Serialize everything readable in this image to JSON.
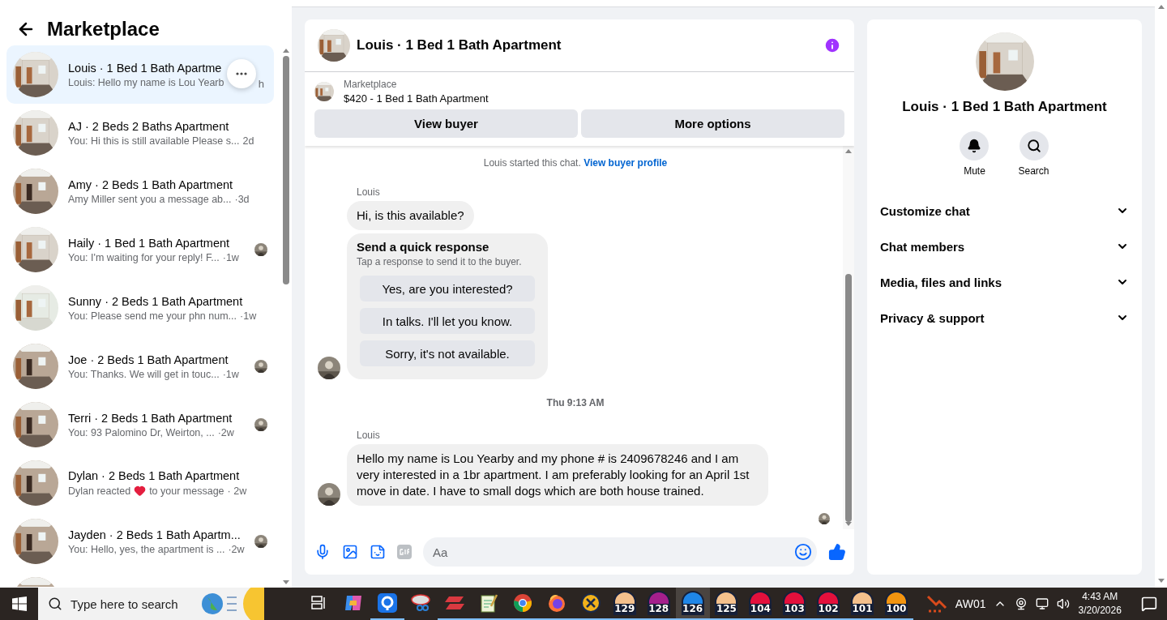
{
  "header": {
    "title": "Marketplace"
  },
  "conversations": [
    {
      "kind": "chat",
      "title": "Louis · 1 Bed 1 Bath Apartme",
      "preview": "Louis: Hello my name is Lou Yearb",
      "time": "h",
      "selected": true,
      "seen": false
    },
    {
      "kind": "chat",
      "title": "AJ · 2 Beds 2 Baths Apartment",
      "preview": "You: Hi this is still available Please s...",
      "time": "2d",
      "selected": false,
      "seen": false
    },
    {
      "kind": "chat",
      "title": "Amy · 2 Beds 1 Bath Apartment",
      "preview": "Amy Miller sent you a message ab...",
      "time": "·3d",
      "selected": false,
      "seen": false
    },
    {
      "kind": "chat",
      "title": "Haily · 1 Bed 1 Bath Apartment",
      "preview": "You: I'm waiting for your reply! F...",
      "time": "·1w",
      "selected": false,
      "seen": true
    },
    {
      "kind": "chat",
      "title": "Sunny · 2 Beds 1 Bath Apartment",
      "preview": "You: Please send me your phn num...",
      "time": "·1w",
      "selected": false,
      "seen": false
    },
    {
      "kind": "chat",
      "title": "Joe · 2 Beds 1 Bath Apartment",
      "preview": "You: Thanks. We will get in touc...",
      "time": "·1w",
      "selected": false,
      "seen": true
    },
    {
      "kind": "chat",
      "title": "Terri · 2 Beds 1 Bath Apartment",
      "preview": "You: 93 Palomino Dr, Weirton, ...",
      "time": "·2w",
      "selected": false,
      "seen": true
    },
    {
      "kind": "reaction",
      "title": "Dylan · 2 Beds 1 Bath Apartment",
      "preview": "Dylan reacted",
      "preview_end": "to your message",
      "time": "· 2w",
      "selected": false,
      "seen": false
    },
    {
      "kind": "chat",
      "title": "Jayden · 2 Beds 1 Bath Apartm...",
      "preview": "You: Hello, yes, the apartment is ...",
      "time": "·2w",
      "selected": false,
      "seen": true
    },
    {
      "kind": "cut"
    }
  ],
  "chat": {
    "title": "Louis · 1 Bed 1 Bath Apartment",
    "listing": {
      "label": "Marketplace",
      "text": "$420 - 1 Bed 1 Bath Apartment"
    },
    "actions": [
      "View buyer",
      "More options"
    ],
    "messages": [
      {
        "kind": "notice",
        "text": "Louis started this chat.",
        "link": "View buyer profile"
      },
      {
        "kind": "group",
        "sender": "Louis",
        "items": [
          {
            "kind": "bubble",
            "text": "Hi, is this available?"
          },
          {
            "kind": "quick",
            "title": "Send a quick response",
            "hint": "Tap a response to send it to the buyer.",
            "options": [
              "Yes, are you interested?",
              "In talks. I'll let you know.",
              "Sorry, it's not available."
            ]
          }
        ]
      },
      {
        "kind": "time",
        "text": "Thu 9:13 AM"
      },
      {
        "kind": "group",
        "sender": "Louis",
        "items": [
          {
            "kind": "bubble",
            "text": "Hello my name is Lou Yearby and my phone # is 2409678246 and I am very interested in a 1br apartment. I am preferably looking for an April 1st move in date. I have to small dogs which are both house trained."
          }
        ]
      }
    ],
    "read_receipt": true,
    "composer": {
      "placeholder": "Aa"
    }
  },
  "details": {
    "title": "Louis · 1 Bed 1 Bath Apartment",
    "actions": [
      {
        "kind": "mute",
        "label": "Mute"
      },
      {
        "kind": "search",
        "label": "Search"
      }
    ],
    "sections": [
      {
        "label": "Customize chat",
        "expanded": false
      },
      {
        "label": "Chat members",
        "expanded": false
      },
      {
        "label": "Media, files and links",
        "expanded": false
      },
      {
        "label": "Privacy & support",
        "expanded": false
      }
    ]
  },
  "taskbar": {
    "search_placeholder": "Type here to search",
    "apps": [
      {
        "kind": "taskview",
        "running": false,
        "selected": false
      },
      {
        "kind": "copilot",
        "running": false,
        "selected": false
      },
      {
        "kind": "maps",
        "running": true,
        "selected": false
      },
      {
        "kind": "snip",
        "running": false,
        "selected": false
      },
      {
        "kind": "vpn",
        "running": true,
        "selected": false
      },
      {
        "kind": "notepad",
        "running": true,
        "selected": false
      },
      {
        "kind": "chrome",
        "running": true,
        "selected": false
      },
      {
        "kind": "firefox",
        "running": true,
        "selected": false
      },
      {
        "kind": "ix",
        "running": true,
        "selected": false
      },
      {
        "kind": "badge",
        "label": "129",
        "color": "#f4c08c",
        "running": true,
        "selected": false
      },
      {
        "kind": "badge",
        "label": "128",
        "color": "#a41f8c",
        "running": true,
        "selected": false
      },
      {
        "kind": "badge",
        "label": "126",
        "color": "#1f86e8",
        "running": true,
        "selected": true
      },
      {
        "kind": "badge",
        "label": "125",
        "color": "#f4c08c",
        "running": true,
        "selected": false
      },
      {
        "kind": "badge",
        "label": "104",
        "color": "#e3103c",
        "running": true,
        "selected": false
      },
      {
        "kind": "badge",
        "label": "103",
        "color": "#e3103c",
        "running": true,
        "selected": false
      },
      {
        "kind": "badge",
        "label": "102",
        "color": "#e3103c",
        "running": true,
        "selected": false
      },
      {
        "kind": "badge",
        "label": "101",
        "color": "#f4c08c",
        "running": true,
        "selected": false
      },
      {
        "kind": "badge",
        "label": "100",
        "color": "#f29410",
        "running": true,
        "selected": false
      }
    ],
    "tray_label": "AW01",
    "clock": {
      "time": "4:43 AM",
      "date": "3/20/2026"
    }
  }
}
